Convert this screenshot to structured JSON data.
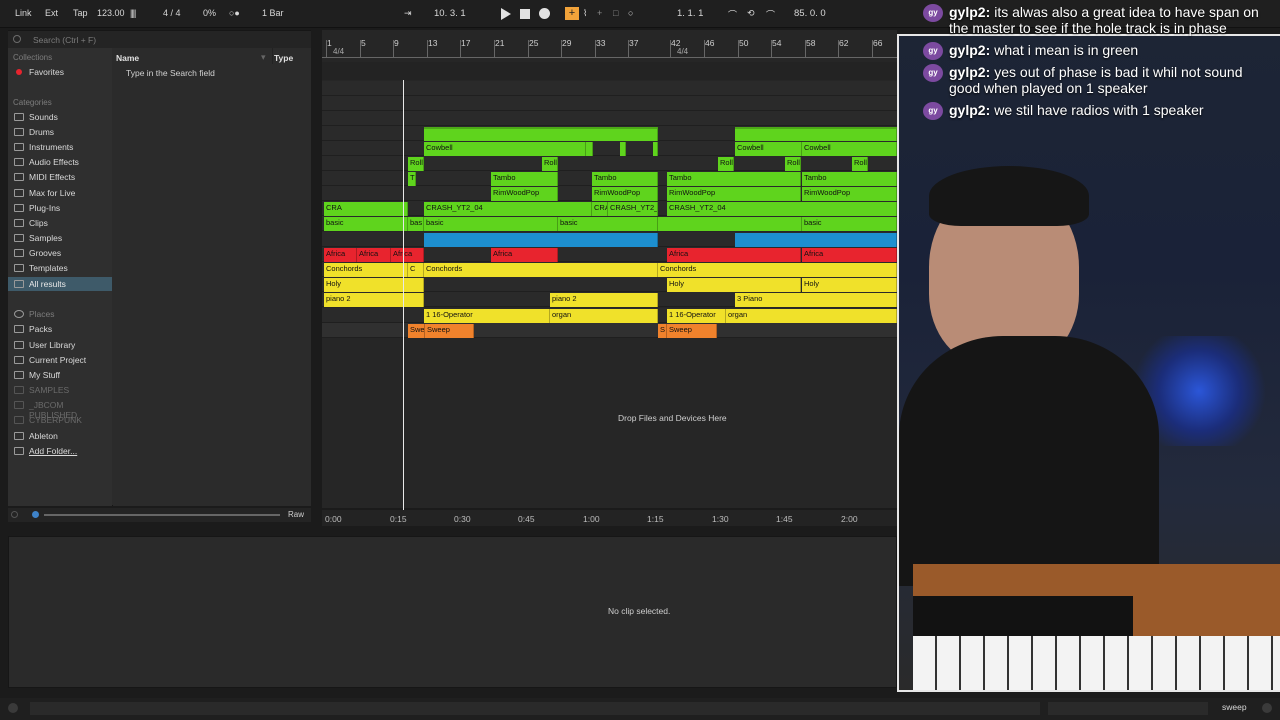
{
  "transport": {
    "link": "Link",
    "ext": "Ext",
    "tap": "Tap",
    "tempo": "123.00",
    "time_signature": "4 / 4",
    "cpu": "0%",
    "quantize": "1 Bar",
    "position": "10.   3.   1",
    "loop_start": "1.   1.   1",
    "loop_length": "85.   0.   0"
  },
  "browser": {
    "search_placeholder": "Search (Ctrl + F)",
    "collections_title": "Collections",
    "favorites": "Favorites",
    "categories_title": "Categories",
    "categories": [
      "Sounds",
      "Drums",
      "Instruments",
      "Audio Effects",
      "MIDI Effects",
      "Max for Live",
      "Plug-Ins",
      "Clips",
      "Samples",
      "Grooves",
      "Templates",
      "All results"
    ],
    "places_title": "Places",
    "places": [
      "Packs",
      "User Library",
      "Current Project",
      "My Stuff"
    ],
    "places_dim": [
      "SAMPLES",
      "_JBCOM PUBLISHED",
      "CYBERPUNK"
    ],
    "places_more": [
      "Ableton",
      "Add Folder..."
    ],
    "col_name": "Name",
    "col_type": "Type",
    "hint": "Type in the Search field",
    "preview_raw": "Raw"
  },
  "arrangement": {
    "ruler_bars": [
      "1",
      "5",
      "9",
      "13",
      "17",
      "21",
      "25",
      "29",
      "33",
      "37",
      "42",
      "46",
      "50",
      "54",
      "58",
      "62",
      "66"
    ],
    "time_sig_marks": [
      "4/4",
      "4/4"
    ],
    "clip_labels": {
      "cowbell": "Cowbell",
      "roll": "Roll",
      "tambo": "Tambo",
      "rimwood": "RimWoodPop",
      "crash": "CRASH_YT2_04",
      "cra_short": "CRA",
      "basic": "basic",
      "bas": "bas",
      "africa": "Africa",
      "conchords": "Conchords",
      "holy": "Holy",
      "piano2": "piano 2",
      "piano3": "3 Piano",
      "operator": "1 16-Operator",
      "organ": "organ",
      "sweep": "Sweep",
      "swe": "Swe",
      "t": "T",
      "c": "C",
      "o": "o",
      "s": "S"
    },
    "drop_hint": "Drop Files and Devices Here",
    "time_labels": [
      "0:00",
      "0:15",
      "0:30",
      "0:45",
      "1:00",
      "1:15",
      "1:30",
      "1:45",
      "2:00"
    ]
  },
  "detail": {
    "empty_text": "No clip selected."
  },
  "status": {
    "track_name": "sweep"
  },
  "chat": [
    {
      "avatar": "gy",
      "user": "gylp2:",
      "text": "its alwas also a great idea to have span on the master to see if the hole track is in phase"
    },
    {
      "avatar": "gy",
      "user": "gylp2:",
      "text": "what i mean is in green"
    },
    {
      "avatar": "gy",
      "user": "gylp2:",
      "text": "yes out of phase is bad it whil not sound good when played on 1 speaker"
    },
    {
      "avatar": "gy",
      "user": "gylp2:",
      "text": "we stil have radios with 1 speaker"
    }
  ],
  "colors": {
    "green": "#5fd41d",
    "yellow": "#f0e12a",
    "red": "#e8242e",
    "blue": "#1d8fcf",
    "orange": "#f0822c",
    "accent": "#f2a33a"
  }
}
